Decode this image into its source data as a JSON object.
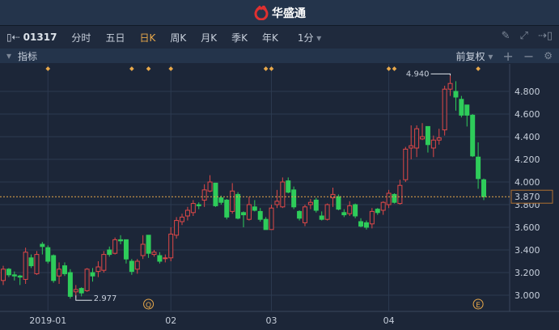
{
  "app": {
    "title": "华盛通"
  },
  "toolbar": {
    "code": "01317",
    "tabs": [
      "分时",
      "五日",
      "日K",
      "周K",
      "月K",
      "季K",
      "年K"
    ],
    "active_tab": "日K",
    "interval": "1分"
  },
  "subbar": {
    "indicator_label": "指标",
    "adjust": "前复权"
  },
  "colors": {
    "up": "#e04848",
    "down": "#2ecc5a",
    "accent": "#e8a84a",
    "grid": "#2c3a50"
  },
  "chart_data": {
    "type": "candlestick",
    "y_ticks": [
      "4.800",
      "4.600",
      "4.400",
      "4.200",
      "4.000",
      "3.800",
      "3.600",
      "3.400",
      "3.200",
      "3.000"
    ],
    "y_tick_values": [
      4.8,
      4.6,
      4.4,
      4.2,
      4.0,
      3.8,
      3.6,
      3.4,
      3.2,
      3.0
    ],
    "x_ticks": [
      {
        "label": "2019-01",
        "index": 8
      },
      {
        "label": "02",
        "index": 30
      },
      {
        "label": "03",
        "index": 48
      },
      {
        "label": "04",
        "index": 69
      }
    ],
    "current_price": "3.870",
    "current_value": 3.87,
    "max_label": "4.940",
    "max_value": 4.94,
    "max_index": 80,
    "min_label": "2.977",
    "min_value": 2.977,
    "min_index": 13,
    "event_markers": [
      {
        "label": "Q",
        "index": 26
      },
      {
        "label": "E",
        "index": 85
      }
    ],
    "diamond_indices": [
      8,
      23,
      26,
      30,
      47,
      48,
      69,
      70,
      85
    ],
    "ohlc": [
      [
        3.13,
        3.26,
        3.09,
        3.23
      ],
      [
        3.23,
        3.24,
        3.16,
        3.18
      ],
      [
        3.18,
        3.21,
        3.13,
        3.17
      ],
      [
        3.17,
        3.18,
        3.09,
        3.16
      ],
      [
        3.14,
        3.42,
        3.1,
        3.38
      ],
      [
        3.33,
        3.36,
        3.24,
        3.26
      ],
      [
        3.19,
        3.39,
        3.18,
        3.36
      ],
      [
        3.45,
        3.47,
        3.36,
        3.43
      ],
      [
        3.42,
        3.44,
        3.28,
        3.3
      ],
      [
        3.35,
        3.36,
        3.11,
        3.13
      ],
      [
        3.17,
        3.29,
        3.1,
        3.23
      ],
      [
        3.26,
        3.29,
        3.17,
        3.19
      ],
      [
        3.2,
        3.23,
        2.97,
        2.99
      ],
      [
        3.03,
        3.09,
        2.977,
        3.05
      ],
      [
        3.06,
        3.07,
        2.99,
        3.02
      ],
      [
        3.04,
        3.24,
        3.03,
        3.23
      ],
      [
        3.2,
        3.24,
        3.12,
        3.17
      ],
      [
        3.21,
        3.3,
        3.16,
        3.25
      ],
      [
        3.22,
        3.39,
        3.2,
        3.36
      ],
      [
        3.4,
        3.43,
        3.34,
        3.36
      ],
      [
        3.37,
        3.51,
        3.36,
        3.49
      ],
      [
        3.49,
        3.53,
        3.45,
        3.48
      ],
      [
        3.49,
        3.49,
        3.28,
        3.32
      ],
      [
        3.3,
        3.32,
        3.18,
        3.21
      ],
      [
        3.23,
        3.32,
        3.19,
        3.3
      ],
      [
        3.35,
        3.53,
        3.32,
        3.45
      ],
      [
        3.53,
        3.53,
        3.33,
        3.37
      ],
      [
        3.36,
        3.4,
        3.34,
        3.38
      ],
      [
        3.35,
        3.38,
        3.28,
        3.3
      ],
      [
        3.33,
        3.36,
        3.29,
        3.33
      ],
      [
        3.33,
        3.6,
        3.3,
        3.54
      ],
      [
        3.53,
        3.69,
        3.5,
        3.66
      ],
      [
        3.65,
        3.72,
        3.62,
        3.69
      ],
      [
        3.7,
        3.78,
        3.66,
        3.75
      ],
      [
        3.73,
        3.84,
        3.7,
        3.81
      ],
      [
        3.8,
        3.82,
        3.76,
        3.79
      ],
      [
        3.84,
        3.98,
        3.78,
        3.93
      ],
      [
        3.92,
        4.06,
        3.91,
        4.0
      ],
      [
        3.99,
        3.99,
        3.78,
        3.79
      ],
      [
        3.86,
        3.88,
        3.8,
        3.82
      ],
      [
        3.84,
        3.85,
        3.67,
        3.69
      ],
      [
        3.74,
        3.99,
        3.72,
        3.92
      ],
      [
        3.89,
        3.91,
        3.67,
        3.68
      ],
      [
        3.73,
        3.74,
        3.6,
        3.71
      ],
      [
        3.67,
        3.87,
        3.66,
        3.8
      ],
      [
        3.78,
        3.84,
        3.74,
        3.75
      ],
      [
        3.74,
        3.77,
        3.65,
        3.67
      ],
      [
        3.67,
        3.69,
        3.58,
        3.58
      ],
      [
        3.58,
        3.8,
        3.58,
        3.77
      ],
      [
        3.8,
        3.93,
        3.77,
        3.83
      ],
      [
        3.78,
        4.04,
        3.77,
        4.0
      ],
      [
        4.01,
        4.04,
        3.9,
        3.91
      ],
      [
        3.93,
        3.96,
        3.76,
        3.78
      ],
      [
        3.74,
        3.75,
        3.66,
        3.68
      ],
      [
        3.64,
        3.8,
        3.61,
        3.78
      ],
      [
        3.8,
        3.85,
        3.76,
        3.82
      ],
      [
        3.84,
        3.86,
        3.73,
        3.75
      ],
      [
        3.7,
        3.74,
        3.66,
        3.67
      ],
      [
        3.67,
        3.81,
        3.66,
        3.8
      ],
      [
        3.86,
        3.95,
        3.78,
        3.89
      ],
      [
        3.87,
        3.89,
        3.75,
        3.76
      ],
      [
        3.73,
        3.76,
        3.69,
        3.71
      ],
      [
        3.72,
        3.83,
        3.7,
        3.79
      ],
      [
        3.8,
        3.81,
        3.68,
        3.7
      ],
      [
        3.65,
        3.68,
        3.6,
        3.61
      ],
      [
        3.64,
        3.66,
        3.58,
        3.6
      ],
      [
        3.63,
        3.77,
        3.59,
        3.74
      ],
      [
        3.76,
        3.77,
        3.71,
        3.73
      ],
      [
        3.75,
        3.83,
        3.71,
        3.82
      ],
      [
        3.8,
        3.93,
        3.77,
        3.9
      ],
      [
        3.89,
        3.9,
        3.81,
        3.82
      ],
      [
        3.81,
        4.02,
        3.8,
        3.97
      ],
      [
        4.02,
        4.31,
        4.0,
        4.29
      ],
      [
        4.3,
        4.5,
        4.2,
        4.32
      ],
      [
        4.3,
        4.5,
        4.22,
        4.47
      ],
      [
        4.38,
        4.52,
        4.37,
        4.4
      ],
      [
        4.49,
        4.49,
        4.26,
        4.33
      ],
      [
        4.3,
        4.41,
        4.22,
        4.37
      ],
      [
        4.37,
        4.47,
        4.33,
        4.39
      ],
      [
        4.46,
        4.85,
        4.41,
        4.82
      ],
      [
        4.82,
        4.94,
        4.76,
        4.87
      ],
      [
        4.8,
        4.89,
        4.63,
        4.75
      ],
      [
        4.73,
        4.76,
        4.57,
        4.59
      ],
      [
        4.68,
        4.68,
        4.49,
        4.59
      ],
      [
        4.59,
        4.6,
        4.22,
        4.23
      ],
      [
        4.22,
        4.35,
        3.94,
        4.03
      ],
      [
        4.02,
        4.03,
        3.84,
        3.87
      ]
    ]
  }
}
